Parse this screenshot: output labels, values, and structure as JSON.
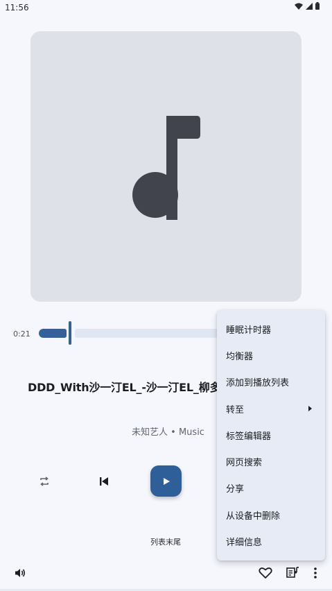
{
  "status_bar": {
    "time": "11:56",
    "icons": [
      "wifi-icon",
      "cellular-signal-icon",
      "battery-icon"
    ]
  },
  "player": {
    "elapsed": "0:21",
    "progress": 0.2,
    "title": "DDD_With沙一汀EL_-沙一汀EL_柳多",
    "artist": "未知艺人",
    "separator": "•",
    "album": "Music",
    "queue_status": "列表末尾",
    "play_state": "paused"
  },
  "controls": {
    "repeat": "repeat-icon",
    "previous": "skip-previous-icon",
    "play": "play-icon",
    "volume": "volume-icon",
    "favorite": "heart-outline-icon",
    "playlist": "playlist-music-icon",
    "more": "more-vert-icon"
  },
  "menu": {
    "items": [
      {
        "label": "睡眠计时器"
      },
      {
        "label": "均衡器"
      },
      {
        "label": "添加到播放列表"
      },
      {
        "label": "转至"
      },
      {
        "label": "标签编辑器"
      },
      {
        "label": "网页搜索"
      },
      {
        "label": "分享"
      },
      {
        "label": "从设备中删除"
      },
      {
        "label": "详细信息"
      }
    ]
  },
  "colors": {
    "background": "#f5f7fd",
    "accent": "#2f5f98",
    "album_placeholder": "#dfe1e9",
    "note_icon": "#41444c",
    "menu_background": "#e6ebf5"
  }
}
